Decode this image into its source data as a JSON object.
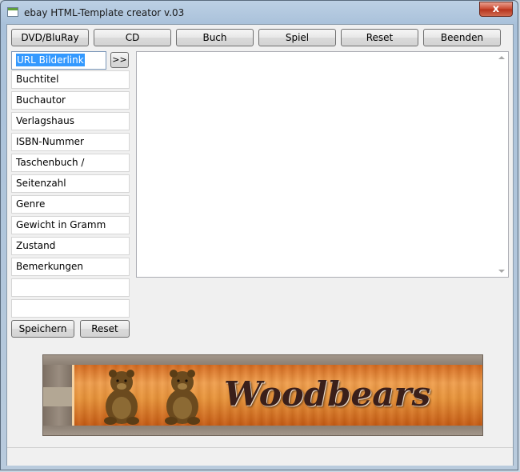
{
  "window": {
    "title": "ebay HTML-Template creator v.03",
    "close_label": "x"
  },
  "toolbar": [
    {
      "name": "dvd-bluray-button",
      "label": "DVD/BluRay"
    },
    {
      "name": "cd-button",
      "label": "CD"
    },
    {
      "name": "buch-button",
      "label": "Buch"
    },
    {
      "name": "spiel-button",
      "label": "Spiel"
    },
    {
      "name": "reset-top-button",
      "label": "Reset"
    },
    {
      "name": "beenden-button",
      "label": "Beenden"
    }
  ],
  "form": {
    "url_field": "URL Bilderlink",
    "arrow_button": ">>",
    "fields": [
      "Buchtitel",
      "Buchautor",
      "Verlagshaus",
      "ISBN-Nummer",
      "Taschenbuch / Hardband",
      "Seitenzahl",
      "Genre",
      "Gewicht in Gramm",
      "Zustand",
      "Bemerkungen",
      "",
      ""
    ],
    "save_label": "Speichern",
    "reset_label": "Reset"
  },
  "output": {
    "text": ""
  },
  "banner": {
    "brand": "Woodbears"
  },
  "colors": {
    "selection": "#3399ff",
    "close": "#c9462d",
    "wood": "#e8953c"
  }
}
